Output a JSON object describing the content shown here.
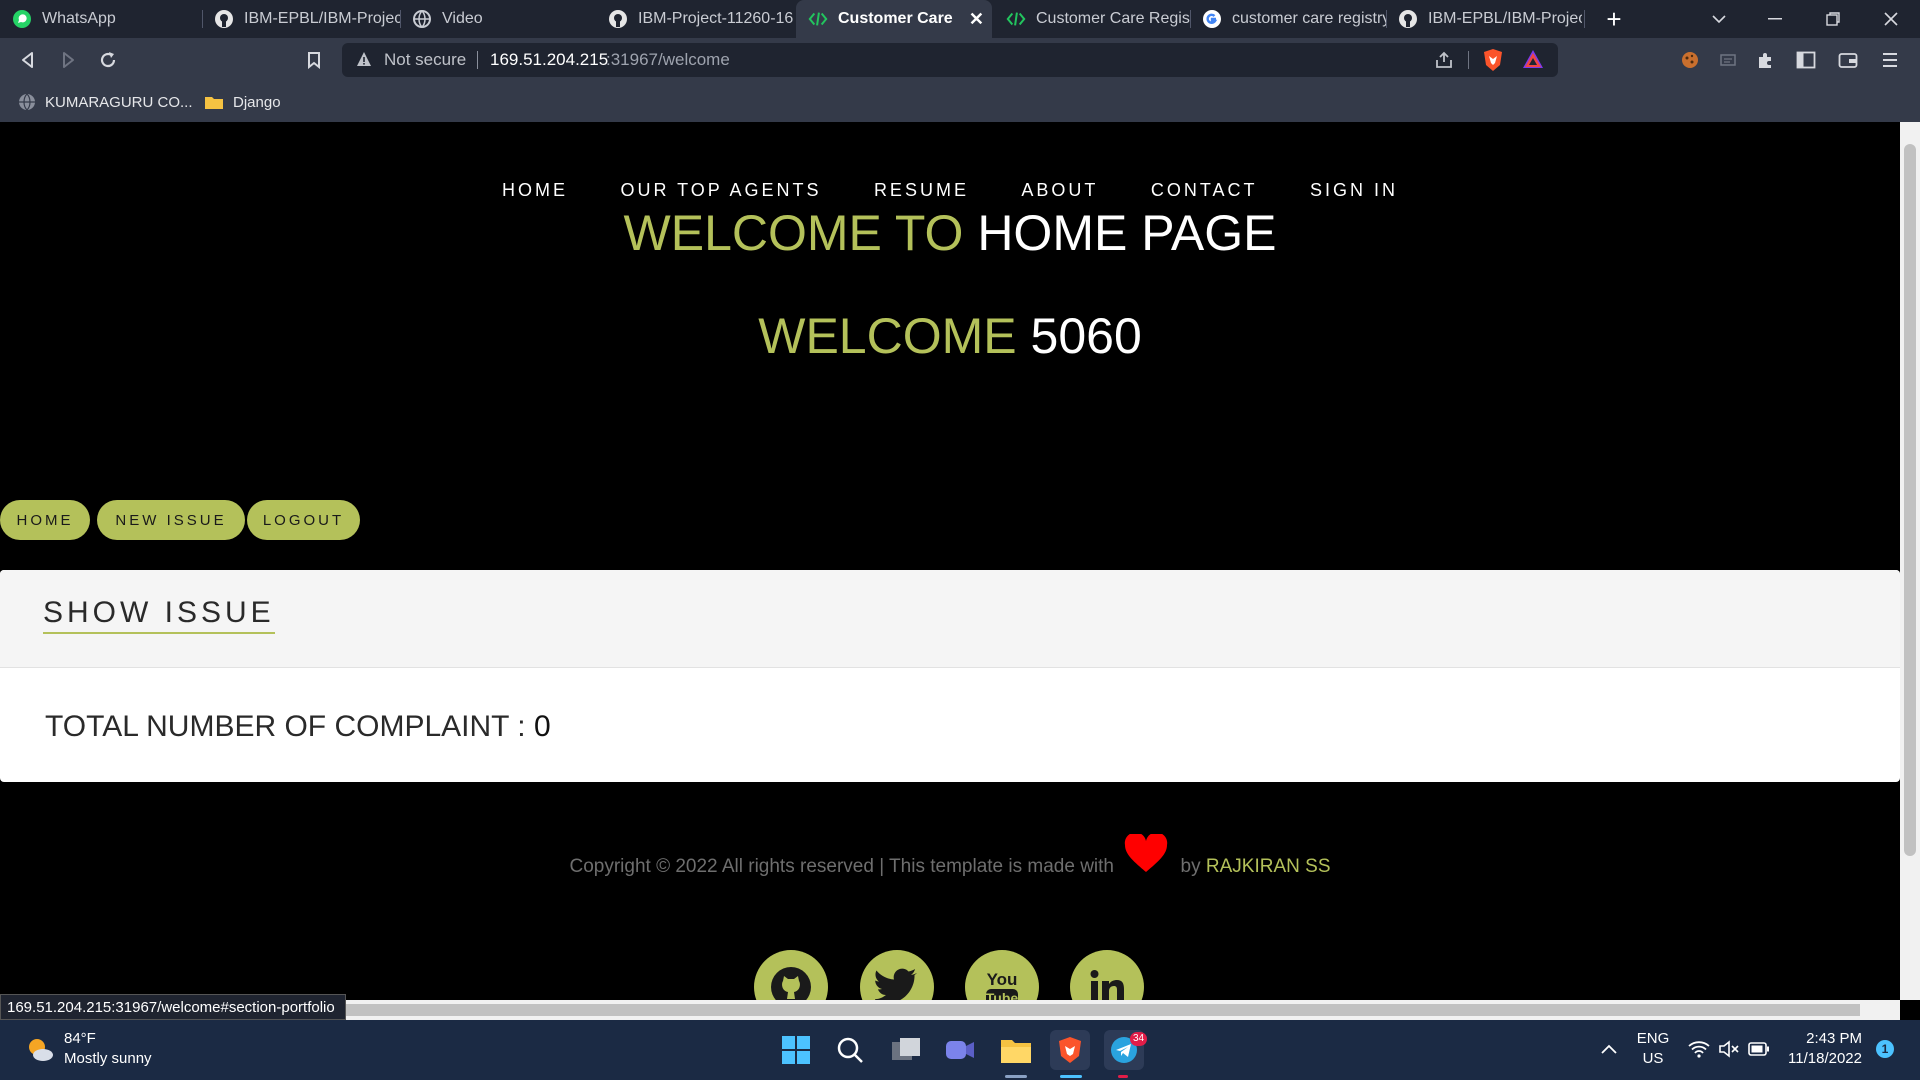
{
  "browser": {
    "tabs": [
      {
        "label": "WhatsApp",
        "icon": "whatsapp-icon"
      },
      {
        "label": "IBM-EPBL/IBM-Project",
        "icon": "github-icon"
      },
      {
        "label": "Video",
        "icon": "globe-icon"
      },
      {
        "label": "IBM-Project-11260-16",
        "icon": "github-icon"
      },
      {
        "label": "Customer Care Re",
        "icon": "code-icon",
        "active": true
      },
      {
        "label": "Customer Care Registr",
        "icon": "code-icon"
      },
      {
        "label": "customer care registry",
        "icon": "google-icon"
      },
      {
        "label": "IBM-EPBL/IBM-Project",
        "icon": "github-icon"
      }
    ],
    "new_tab": "+",
    "address": {
      "security": "Not secure",
      "host": "169.51.204.215",
      "path": ":31967/welcome"
    },
    "bookmarks": [
      {
        "label": "KUMARAGURU CO...",
        "icon": "globe-icon"
      },
      {
        "label": "Django",
        "icon": "folder-icon"
      }
    ],
    "status_url": "169.51.204.215:31967/welcome#section-portfolio"
  },
  "page": {
    "nav": [
      "HOME",
      "OUR TOP AGENTS",
      "RESUME",
      "ABOUT",
      "CONTACT",
      "SIGN IN"
    ],
    "heading1": {
      "accent": "WELCOME TO",
      "rest": "HOME PAGE"
    },
    "heading2": {
      "accent": "WELCOME",
      "rest": "5060"
    },
    "actions": [
      "HOME",
      "NEW ISSUE",
      "LOGOUT"
    ],
    "card": {
      "title": "SHOW ISSUE",
      "complaint_label": "TOTAL NUMBER OF COMPLAINT : ",
      "complaint_value": "0"
    },
    "footer": {
      "text": "Copyright © 2022 All rights reserved | This template is made with",
      "by": "by",
      "author": "RAJKIRAN SS"
    },
    "social": [
      "github-icon",
      "twitter-icon",
      "youtube-icon",
      "linkedin-icon"
    ],
    "colors": {
      "accent": "#b4c15a",
      "background": "#000000"
    }
  },
  "taskbar": {
    "weather_temp": "84°F",
    "weather_desc": "Mostly sunny",
    "lang1": "ENG",
    "lang2": "US",
    "time": "2:43 PM",
    "date": "11/18/2022",
    "telegram_badge": "34",
    "notification_count": "1"
  }
}
